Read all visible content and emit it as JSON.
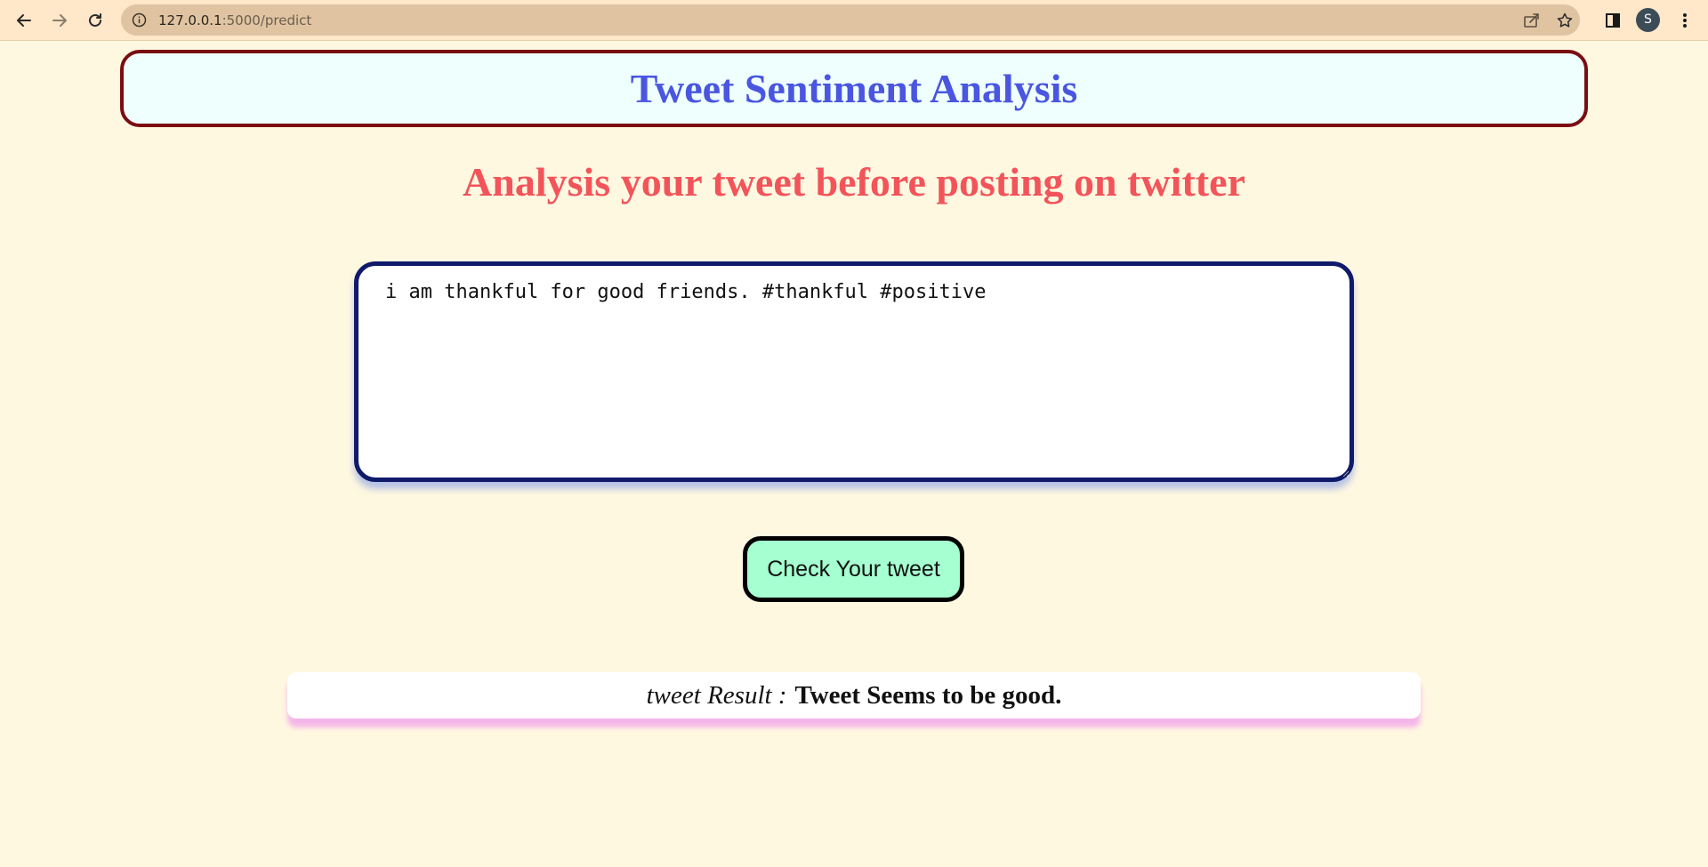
{
  "browser": {
    "url_host": "127.0.0.1",
    "url_path": ":5000/predict",
    "avatar_initial": "S",
    "icons": [
      "back-icon",
      "forward-icon",
      "reload-icon",
      "info-icon",
      "share-icon",
      "star-icon",
      "side-panel-icon",
      "menu-icon"
    ]
  },
  "page": {
    "title": "Tweet Sentiment Analysis",
    "subtitle": "Analysis your tweet before posting on twitter",
    "tweet_text": "i am thankful for good friends. #thankful #positive",
    "check_button_label": "Check Your tweet",
    "result_label": "tweet Result :",
    "result_value": "Tweet Seems to be good."
  },
  "colors": {
    "background": "#fff8e1",
    "title": "#4a55e0",
    "title_border": "#7a0d12",
    "subtitle": "#f2545a",
    "input_border": "#101a6b",
    "button_bg": "#a5ffd0",
    "result_shadow": "#f5b0f0"
  }
}
